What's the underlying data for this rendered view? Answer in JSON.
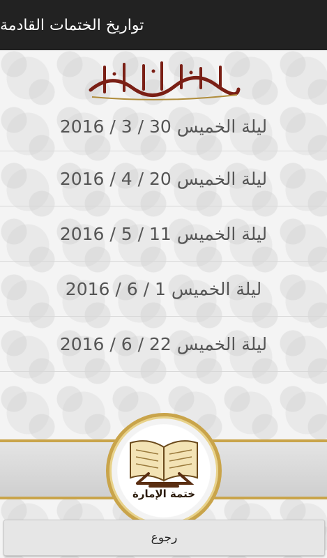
{
  "app_bar": {
    "title": "تواريخ الختمات القادمة"
  },
  "header": {
    "basmala": "بسم الله الرحمن الرحيم",
    "basmala_icon": "calligraphy-basmala"
  },
  "dates": [
    {
      "label": "ليلة الخميس 30 / 3 / 2016"
    },
    {
      "label": "ليلة الخميس 20 / 4 / 2016"
    },
    {
      "label": "ليلة الخميس 11 / 5 / 2016"
    },
    {
      "label": "ليلة الخميس 1 / 6 / 2016"
    },
    {
      "label": "ليلة الخميس 22 / 6 / 2016"
    }
  ],
  "footer": {
    "logo_text": "ختمة الإمارة",
    "logo_icon": "open-quran-icon",
    "back_label": "رجوع"
  },
  "colors": {
    "app_bar": "#222222",
    "gold": "#c9a44a",
    "text": "#555555"
  }
}
